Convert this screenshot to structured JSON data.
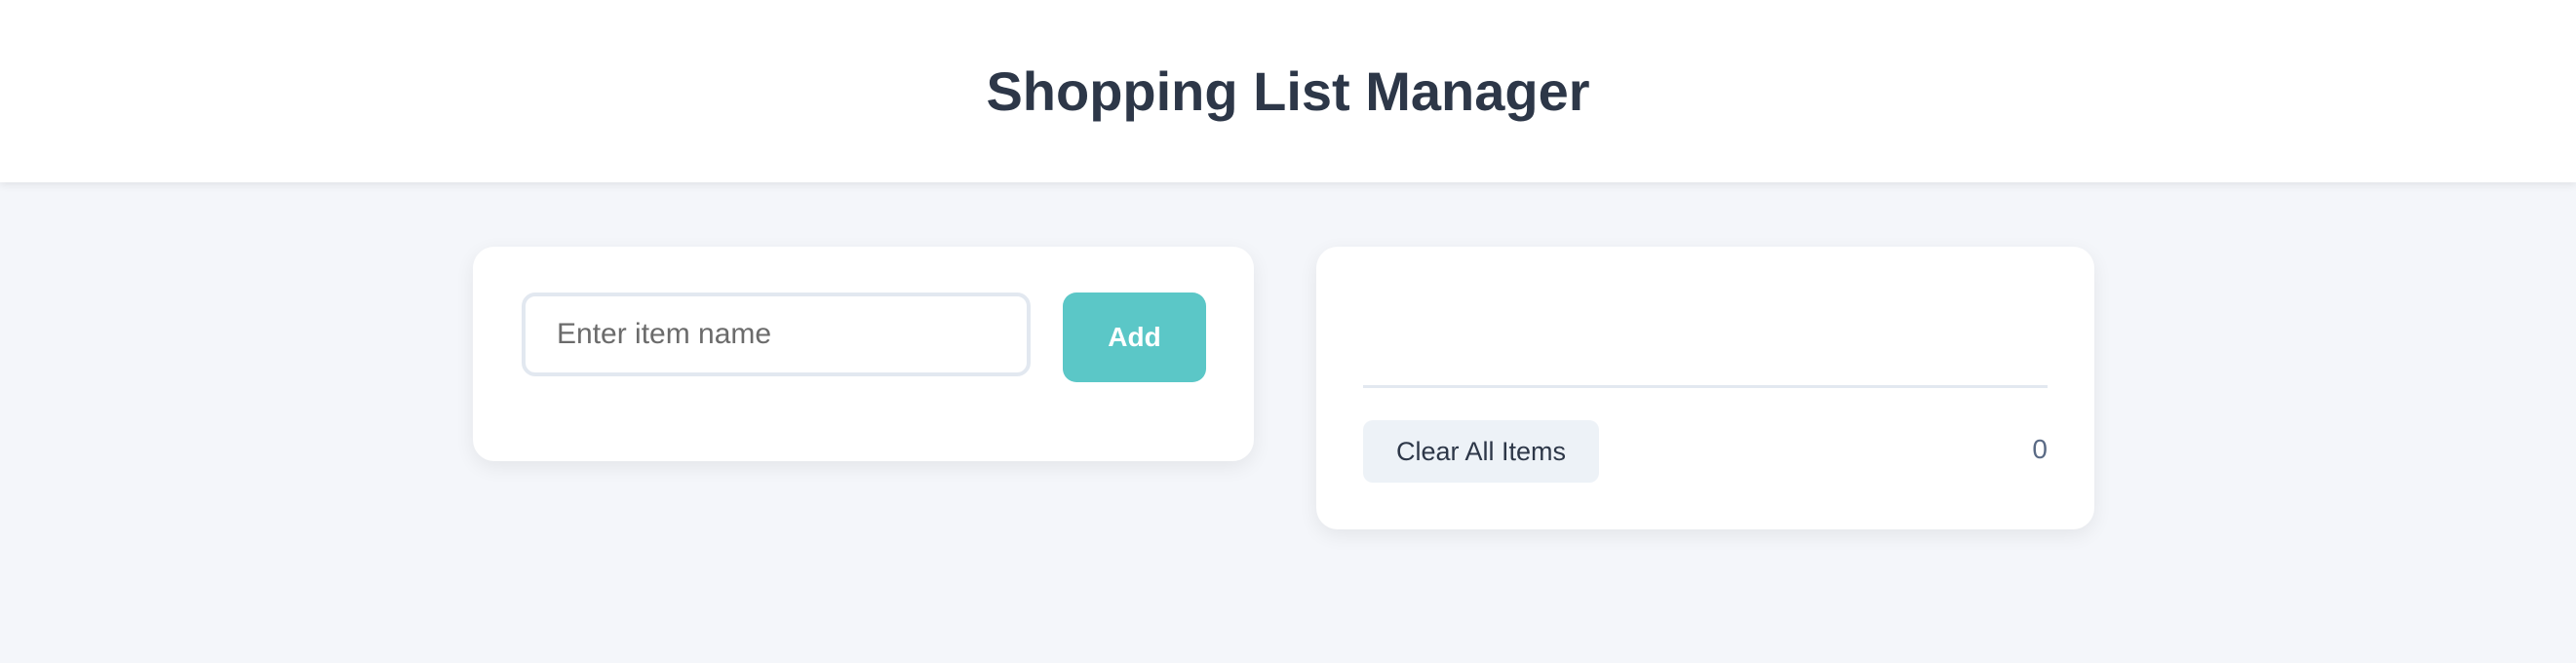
{
  "header": {
    "title": "Shopping List Manager"
  },
  "add_form": {
    "input_value": "",
    "input_placeholder": "Enter item name",
    "add_label": "Add"
  },
  "list": {
    "items": [],
    "clear_label": "Clear All Items",
    "count": "0"
  },
  "colors": {
    "accent": "#5bc7c7",
    "background": "#f4f6fa",
    "title": "#2d3748"
  }
}
